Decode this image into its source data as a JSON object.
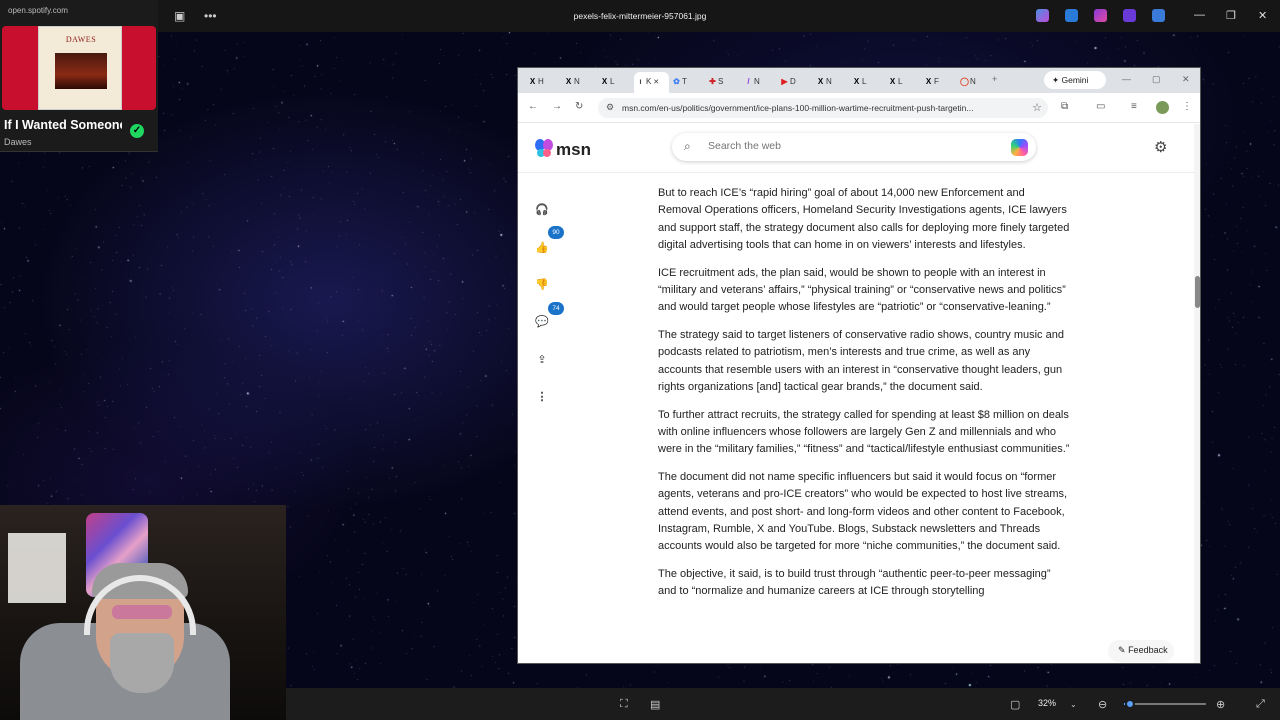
{
  "spotify": {
    "site": "open.spotify.com",
    "album_title": "DAWES",
    "song": "If I Wanted Someone",
    "artist": "Dawes"
  },
  "viewer": {
    "filename": "pexels-felix-mittermeier-957061.jpg",
    "zoom": "32%",
    "zoom_level": 0.05
  },
  "browser": {
    "tabs": [
      {
        "icon": "x-icon",
        "label": "H"
      },
      {
        "icon": "x-icon",
        "label": "N"
      },
      {
        "icon": "x-icon",
        "label": "L"
      },
      {
        "icon": "ice-icon",
        "label": "K",
        "active": true
      },
      {
        "icon": "butterfly-icon",
        "label": "T"
      },
      {
        "icon": "s-icon",
        "label": "S"
      },
      {
        "icon": "slash-icon",
        "label": "N"
      },
      {
        "icon": "youtube-icon",
        "label": "D"
      },
      {
        "icon": "x-icon",
        "label": "N"
      },
      {
        "icon": "x-icon",
        "label": "L"
      },
      {
        "icon": "x-icon",
        "label": "L"
      },
      {
        "icon": "x-icon",
        "label": "F"
      },
      {
        "icon": "red-circle-icon",
        "label": "N"
      }
    ],
    "gemini_label": "Gemini",
    "url": "msn.com/en-us/politics/government/ice-plans-100-million-wartime-recruitment-push-targetin..."
  },
  "msn": {
    "logo": "msn",
    "search_placeholder": "Search the web",
    "likes": "90",
    "comments": "74",
    "feedback": "Feedback"
  },
  "article": {
    "paragraphs": [
      "But to reach ICE’s “rapid hiring” goal of about 14,000 new Enforcement and Removal Operations officers, Homeland Security Investigations agents, ICE lawyers and support staff, the strategy document also calls for deploying more finely targeted digital advertising tools that can home in on viewers’ interests and lifestyles.",
      "ICE recruitment ads, the plan said, would be shown to people with an interest in “military and veterans’ affairs,” “physical training” or “conservative news and politics” and would target people whose lifestyles are “patriotic” or “conservative-leaning.”",
      "The strategy said to target listeners of conservative radio shows, country music and podcasts related to patriotism, men’s interests and true crime, as well as any accounts that resemble users with an interest in “conservative thought leaders, gun rights organizations [and] tactical gear brands,” the document said.",
      "To further attract recruits, the strategy called for spending at least $8 million on deals with online influencers whose followers are largely Gen Z and millennials and who were in the “military families,” “fitness” and “tactical/lifestyle enthusiast communities.”",
      "The document did not name specific influencers but said it would focus on “former agents, veterans and pro-ICE creators” who would be expected to host live streams, attend events, and post short- and long-form videos and other content to Facebook, Instagram, Rumble, X and YouTube. Blogs, Substack newsletters and Threads accounts would also be targeted for more “niche communities,” the document said.",
      "The objective, it said, is to build trust through “authentic peer-to-peer messaging” and to “normalize and humanize careers at ICE through storytelling"
    ]
  }
}
